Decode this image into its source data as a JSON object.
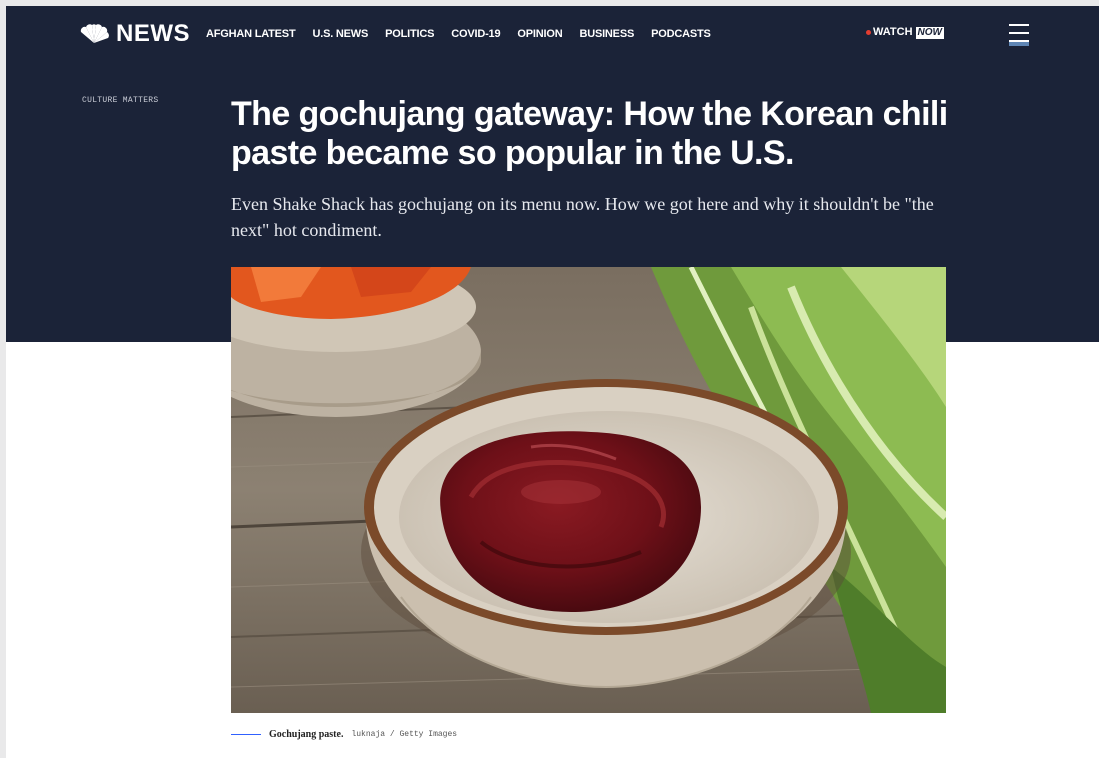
{
  "header": {
    "logo_text": "NEWS",
    "nav": [
      "AFGHAN LATEST",
      "U.S. NEWS",
      "POLITICS",
      "COVID-19",
      "OPINION",
      "BUSINESS",
      "PODCASTS"
    ],
    "watch_label": "WATCH",
    "watch_now": "NOW"
  },
  "article": {
    "section": "CULTURE MATTERS",
    "headline": "The gochujang gateway: How the Korean chili paste became so popular in the U.S.",
    "dek": "Even Shake Shack has gochujang on its menu now. How we got here and why it shouldn't be \"the next\" hot condiment.",
    "caption": "Gochujang paste.",
    "credit": "luknaja / Getty Images"
  },
  "colors": {
    "hero_background": "#1b2338",
    "accent_blue": "#3061ff",
    "live_red": "#e43d30"
  }
}
